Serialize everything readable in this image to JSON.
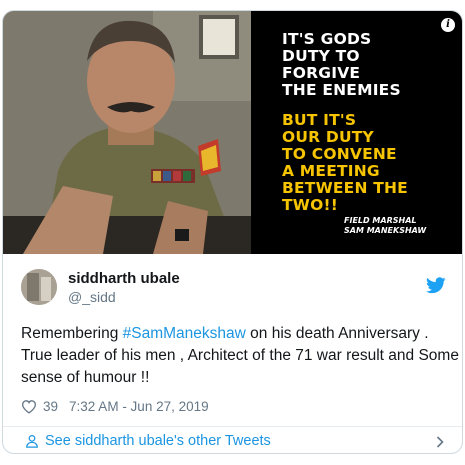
{
  "image": {
    "quote_lines_white": [
      "IT'S GODS",
      "DUTY TO",
      "FORGIVE",
      "THE ENEMIES"
    ],
    "quote_lines_yellow": [
      "BUT IT'S",
      "OUR DUTY",
      "TO CONVENE",
      "A MEETING",
      "BETWEEN THE",
      "TWO!!"
    ],
    "attribution_lines": [
      "FIELD MARSHAL",
      "SAM MANEKSHAW"
    ],
    "info_glyph": "i",
    "quote_yellow_color": "#f6c400"
  },
  "author": {
    "display_name": "siddharth ubale",
    "handle": "@_sidd"
  },
  "tweet": {
    "text_before": "Remembering ",
    "hashtag": "#SamManekshaw",
    "text_after": " on his death Anniversary . True leader of his men , Architect of the 71 war result and Some sense of humour !!"
  },
  "meta": {
    "like_count": "39",
    "timestamp": "7:32 AM - Jun 27, 2019"
  },
  "footer": {
    "link_label": "See siddharth ubale's other Tweets"
  },
  "colors": {
    "link_blue": "#1b95e0",
    "muted_gray": "#657786",
    "text": "#14171a"
  },
  "icons": {
    "brand": "twitter-bird-icon",
    "like": "heart-icon",
    "profile": "person-icon",
    "more": "chevron-right-icon",
    "info": "info-icon"
  }
}
